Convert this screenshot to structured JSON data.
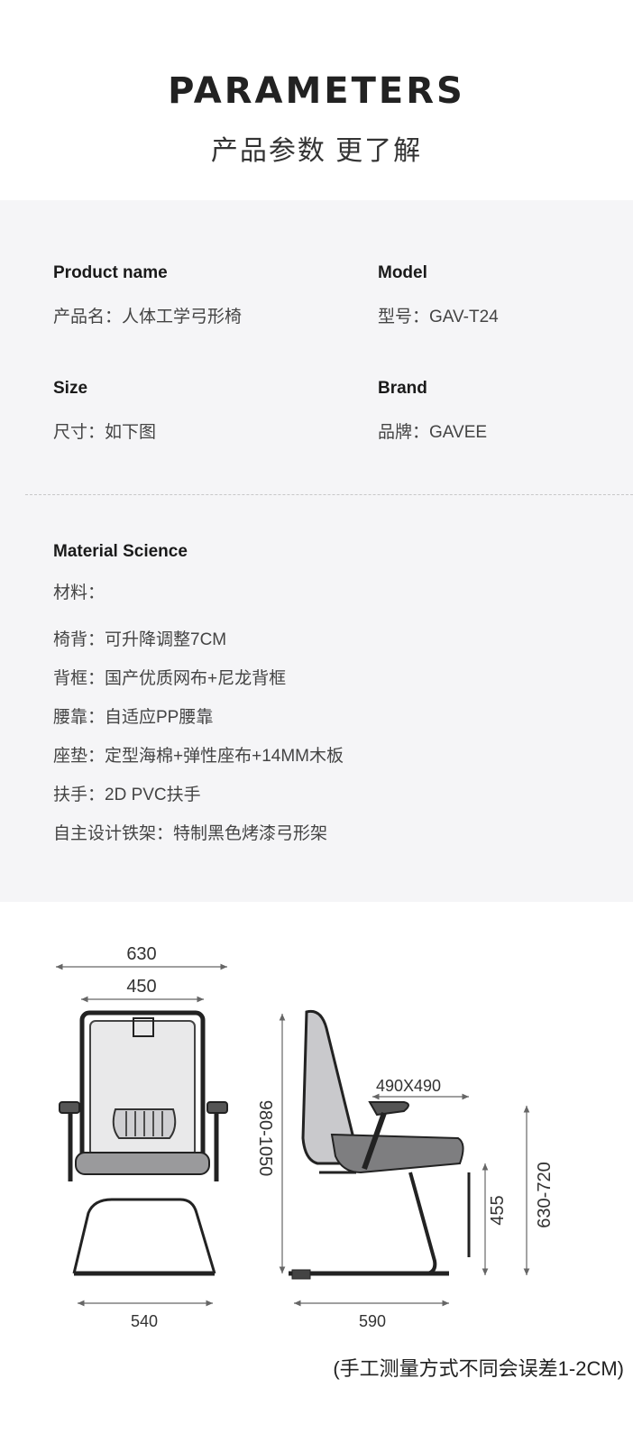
{
  "header": {
    "title": "PARAMETERS",
    "subtitle": "产品参数 更了解"
  },
  "specs": {
    "product_name": {
      "label": "Product name",
      "value": "产品名：人体工学弓形椅"
    },
    "model": {
      "label": "Model",
      "value": "型号：GAV-T24"
    },
    "size": {
      "label": "Size",
      "value": "尺寸：如下图"
    },
    "brand": {
      "label": "Brand",
      "value": "品牌：GAVEE"
    }
  },
  "material": {
    "label": "Material Science",
    "intro": "材料：",
    "items": [
      "椅背：可升降调整7CM",
      "背框：国产优质网布+尼龙背框",
      "腰靠：自适应PP腰靠",
      "座垫：定型海棉+弹性座布+14MM木板",
      "扶手：2D PVC扶手",
      "自主设计铁架：特制黑色烤漆弓形架"
    ]
  },
  "dimensions": {
    "front_width_total": "630",
    "front_width_back": "450",
    "front_base_width": "540",
    "side_height_total": "980-1050",
    "side_seat_size": "490X490",
    "side_seat_height": "455",
    "side_armrest_height": "630-720",
    "side_depth": "590"
  },
  "note": "(手工测量方式不同会误差1-2CM)"
}
